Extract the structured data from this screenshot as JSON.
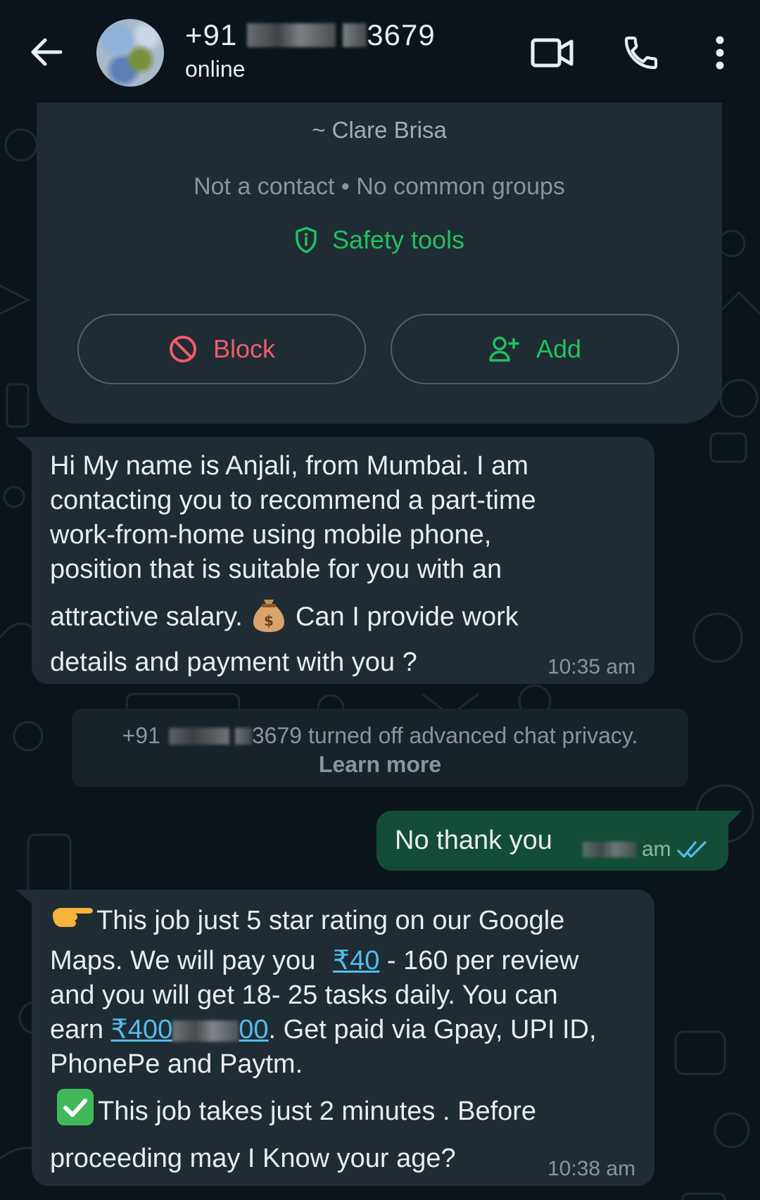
{
  "header": {
    "phone_prefix": "+91",
    "phone_suffix": "3679",
    "status": "online",
    "icons": [
      "back-arrow-icon",
      "video-call-icon",
      "voice-call-icon",
      "more-vertical-icon"
    ]
  },
  "info_card": {
    "alias": "~ Clare Brisa",
    "meta": "Not a contact • No common groups",
    "safety_tools": "Safety tools",
    "block_label": "Block",
    "add_label": "Add"
  },
  "messages": {
    "m1": {
      "line1": "Hi My name is Anjali, from Mumbai. I am",
      "line2": "contacting you to recommend a part-time",
      "line3": "work-from-home using mobile phone,",
      "line4": "position that is suitable for you with an",
      "line5a": "attractive salary.",
      "line5b": "Can I provide work",
      "line6": "details and payment with you ?",
      "time": "10:35 am"
    },
    "system": {
      "prefix": "+91",
      "suffix": "3679 turned off advanced chat privacy.",
      "learn_more": "Learn more"
    },
    "m2": {
      "text": "No thank you",
      "time_suffix": "am"
    },
    "m3": {
      "line1": "This job just 5 star rating on our Google",
      "line2a": "Maps. We will pay you",
      "line2link": "₹40",
      "line2b": "- 160 per review",
      "line3": "and you will get 18- 25 tasks daily. You can",
      "line4a": "earn",
      "line4link1": "₹400",
      "line4link2": "00",
      "line4b": ". Get paid via Gpay, UPI ID,",
      "line5": "PhonePe and Paytm.",
      "line6": "This job takes just 2 minutes . Before",
      "line7": "proceeding may  I Know your age?",
      "time": "10:38 am"
    }
  },
  "colors": {
    "background": "#0b141a",
    "incoming_bubble": "#1f2c33",
    "outgoing_bubble": "#144d37",
    "accent_green": "#21c063",
    "block_red": "#f15c6d",
    "link_blue": "#53bdeb",
    "read_ticks": "#53bdeb"
  }
}
